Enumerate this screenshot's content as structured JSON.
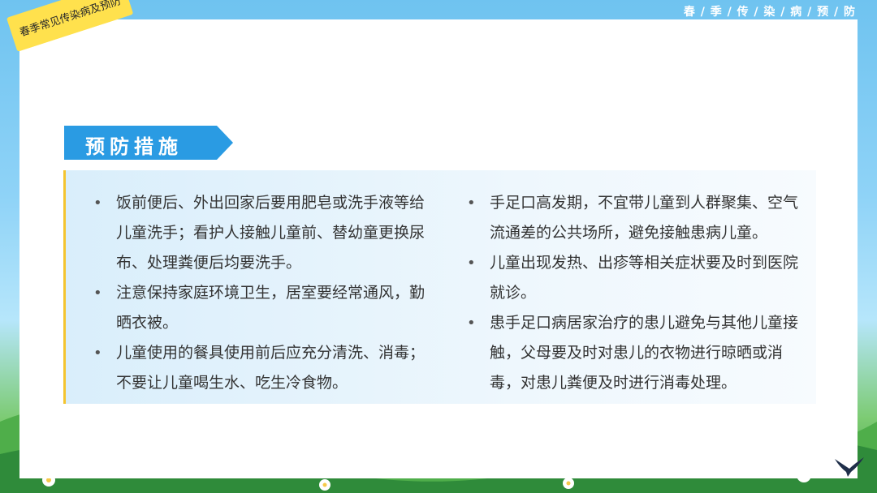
{
  "header": {
    "title": "春 / 季 / 传 / 染 / 病 / 预 / 防"
  },
  "tag": {
    "text": "春季常见传染病及预防"
  },
  "section": {
    "title": "预防措施"
  },
  "left_items": [
    "饭前便后、外出回家后要用肥皂或洗手液等给儿童洗手；看护人接触儿童前、替幼童更换尿布、处理粪便后均要洗手。",
    "注意保持家庭环境卫生，居室要经常通风，勤晒衣被。",
    "儿童使用的餐具使用前后应充分清洗、消毒；不要让儿童喝生水、吃生冷食物。"
  ],
  "right_items": [
    "手足口高发期，不宜带儿童到人群聚集、空气流通差的公共场所，避免接触患病儿童。",
    "儿童出现发热、出疹等相关症状要及时到医院就诊。",
    "患手足口病居家治疗的患儿避免与其他儿童接触，父母要及时对患儿的衣物进行晾晒或消毒，对患儿粪便及时进行消毒处理。"
  ],
  "bullet": "•",
  "colors": {
    "accent": "#2a9be3",
    "tag": "#ffe14d",
    "border": "#f4c430"
  }
}
